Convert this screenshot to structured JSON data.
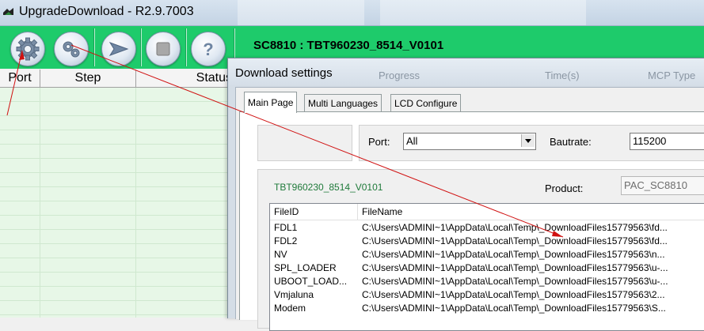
{
  "window": {
    "title": "UpgradeDownload - R2.9.7003"
  },
  "toolbar": {
    "buttons": [
      {
        "name": "settings",
        "icon": "gear-icon"
      },
      {
        "name": "advanced-settings",
        "icon": "gears-icon"
      },
      {
        "name": "start",
        "icon": "play-arrow-icon"
      },
      {
        "name": "stop",
        "icon": "stop-square-icon"
      },
      {
        "name": "help",
        "icon": "question-icon",
        "glyph": "?"
      }
    ],
    "title": "SC8810 : TBT960230_8514_V0101"
  },
  "grid": {
    "columns": [
      "Port",
      "Step",
      "Status"
    ]
  },
  "dialog": {
    "title": "Download settings",
    "background_columns": [
      "Progress",
      "Time(s)",
      "MCP Type"
    ],
    "tabs": [
      "Main Page",
      "Multi Languages",
      "LCD Configure"
    ],
    "port_label": "Port:",
    "port_value": "All",
    "baudrate_label": "Bautrate:",
    "baudrate_value": "115200",
    "pac_name": "TBT960230_8514_V0101",
    "product_label": "Product:",
    "product_value": "PAC_SC8810",
    "file_list": {
      "headers": [
        "FileID",
        "FileName"
      ],
      "rows": [
        {
          "id": "FDL1",
          "file": "C:\\Users\\ADMINI~1\\AppData\\Local\\Temp\\_DownloadFiles15779563\\fd..."
        },
        {
          "id": "FDL2",
          "file": "C:\\Users\\ADMINI~1\\AppData\\Local\\Temp\\_DownloadFiles15779563\\fd..."
        },
        {
          "id": "NV",
          "file": "C:\\Users\\ADMINI~1\\AppData\\Local\\Temp\\_DownloadFiles15779563\\n..."
        },
        {
          "id": "SPL_LOADER",
          "file": "C:\\Users\\ADMINI~1\\AppData\\Local\\Temp\\_DownloadFiles15779563\\u-..."
        },
        {
          "id": "UBOOT_LOAD...",
          "file": "C:\\Users\\ADMINI~1\\AppData\\Local\\Temp\\_DownloadFiles15779563\\u-..."
        },
        {
          "id": "Vmjaluna",
          "file": "C:\\Users\\ADMINI~1\\AppData\\Local\\Temp\\_DownloadFiles15779563\\2..."
        },
        {
          "id": "Modem",
          "file": "C:\\Users\\ADMINI~1\\AppData\\Local\\Temp\\_DownloadFiles15779563\\S..."
        }
      ]
    }
  },
  "colors": {
    "toolbar_green": "#1ecb6b",
    "grid_green": "#e7f7e7",
    "annotation_red": "#d01010",
    "pac_text": "#1f7a3a"
  }
}
